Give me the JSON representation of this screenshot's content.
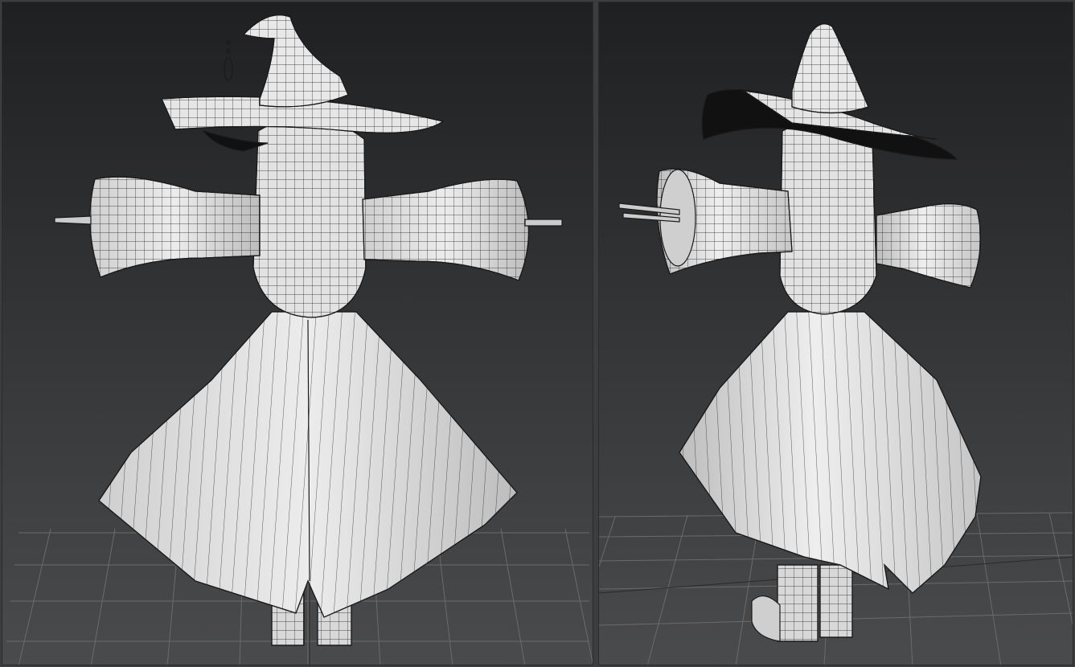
{
  "viewports": [
    {
      "view": "back",
      "content": "witch-character-wireframe-mesh"
    },
    {
      "view": "three-quarter-back",
      "content": "witch-character-wireframe-mesh"
    }
  ],
  "colors": {
    "background_top": "#1f2022",
    "background_bottom": "#4a4b4d",
    "mesh_fill": "#e4e4e4",
    "mesh_shadow": "#9a9a9a",
    "wire": "#1a1a1a",
    "grid": "#6a6b6d",
    "separator": "#2a2b2d"
  }
}
